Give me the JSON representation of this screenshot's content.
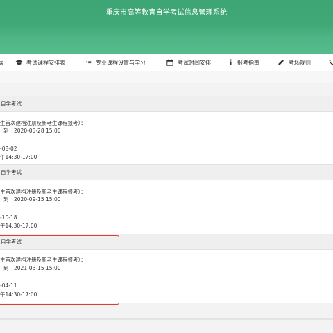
{
  "header": {
    "title": "重庆市高等教育自学考试信息管理系统"
  },
  "nav": {
    "items": [
      {
        "label": "录",
        "icon": "login-icon"
      },
      {
        "label": "考试课程安排表",
        "icon": "graduation-cap-icon"
      },
      {
        "label": "专业课程设置与学分",
        "icon": "id-card-icon"
      },
      {
        "label": "考试时间安排",
        "icon": "calendar-icon"
      },
      {
        "label": "报考指南",
        "icon": "info-icon"
      },
      {
        "label": "考场规则",
        "icon": "pencil-icon"
      },
      {
        "label": "",
        "icon": "phone-icon"
      }
    ]
  },
  "exams": [
    {
      "title": "自学考试",
      "reg_label": "生首次建档注册及新老生课程报考）：",
      "reg_end": "到　2020-05-28 15:00",
      "exam_date": "-08-02",
      "exam_time": "午14:30-17:00"
    },
    {
      "title": "自学考试",
      "reg_label": "生首次建档注册及新老生课程报考）：",
      "reg_end": "到　2020-09-15 15:00",
      "exam_date": "-10-18",
      "exam_time": "午14:30-17:00"
    },
    {
      "title": "自学考试",
      "reg_label": "生首次建档注册及新老生课程报考）：",
      "reg_end": "到　2021-03-15 15:00",
      "exam_date": "-04-11",
      "exam_time": "午14:30-17:00"
    }
  ],
  "colors": {
    "header": "#43aa7a",
    "nav_bg": "#ffffff",
    "highlight": "#e53935"
  }
}
